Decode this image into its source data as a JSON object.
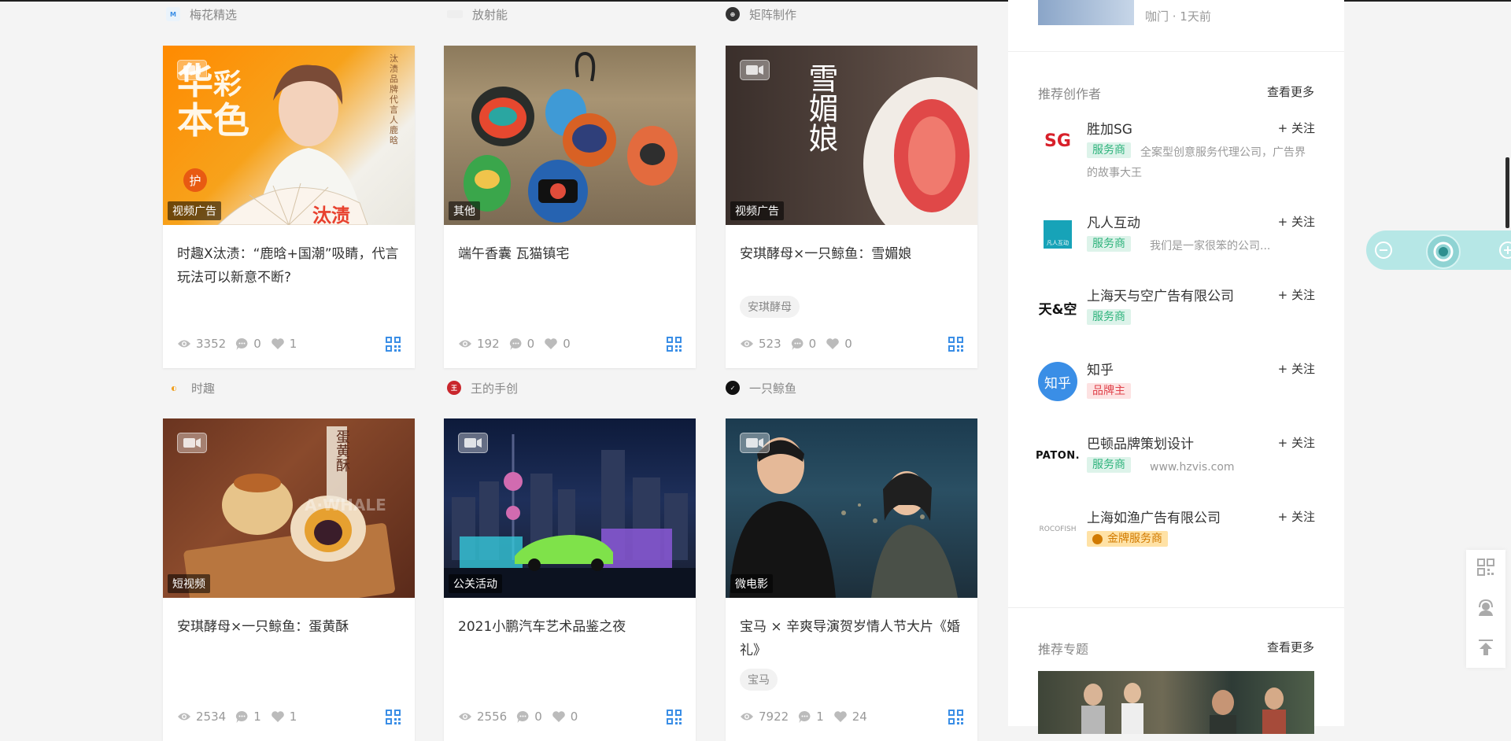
{
  "feed": {
    "authors": [
      {
        "name": "梅花精选"
      },
      {
        "name": "放射能"
      },
      {
        "name": "矩阵制作"
      },
      {
        "name": "时趣"
      },
      {
        "name": "王的手创"
      },
      {
        "name": "一只鲸鱼"
      }
    ],
    "cards": [
      {
        "category": "视频广告",
        "title": "时趣X汰渍：“鹿晗+国潮”吸睛，代言玩法可以新意不断?",
        "views": "3352",
        "comments": "0",
        "likes": "1",
        "has_video": true,
        "image_text": {
          "a": "华",
          "b": "彩",
          "c": "本",
          "d": "色",
          "e": "护",
          "f": "汰渍",
          "g": "汰渍品牌代言人 鹿晗"
        }
      },
      {
        "category": "其他",
        "title": "端午香囊 瓦猫镇宅",
        "views": "192",
        "comments": "0",
        "likes": "0",
        "has_video": false
      },
      {
        "category": "视频广告",
        "title": "安琪酵母×一只鲸鱼：雪媚娘",
        "tag": "安琪酵母",
        "views": "523",
        "comments": "0",
        "likes": "0",
        "has_video": true,
        "image_text": {
          "a": "雪",
          "b": "媚",
          "c": "娘"
        }
      },
      {
        "category": "短视频",
        "title": "安琪酵母×一只鲸鱼：蛋黄酥",
        "views": "2534",
        "comments": "1",
        "likes": "1",
        "has_video": true,
        "image_text": {
          "a": "蛋",
          "b": "黄",
          "c": "酥",
          "w": "A·WHALE"
        }
      },
      {
        "category": "公关活动",
        "title": "2021小鹏汽车艺术品鉴之夜",
        "views": "2556",
        "comments": "0",
        "likes": "0",
        "has_video": true
      },
      {
        "category": "微电影",
        "title": "宝马 × 辛爽导演贺岁情人节大片《婚礼》",
        "tag": "宝马",
        "views": "7922",
        "comments": "1",
        "likes": "24",
        "has_video": true
      }
    ]
  },
  "sidebar": {
    "top_item_meta": "咖门 · 1天前",
    "creators_title": "推荐创作者",
    "more_label": "查看更多",
    "creators": [
      {
        "name": "胜加SG",
        "badge": "服务商",
        "desc": "全案型创意服务代理公司，广告界的故事大王",
        "follow": "+ 关注",
        "logo_text": "SG"
      },
      {
        "name": "凡人互动",
        "badge": "服务商",
        "desc": "我们是一家很笨的公司...",
        "follow": "+ 关注",
        "logo_text": "凡人互动"
      },
      {
        "name": "上海天与空广告有限公司",
        "badge": "服务商",
        "desc": "",
        "follow": "+ 关注",
        "logo_text": "天&空"
      },
      {
        "name": "知乎",
        "badge": "品牌主",
        "desc": "",
        "follow": "+ 关注",
        "logo_text": "知乎"
      },
      {
        "name": "巴顿品牌策划设计",
        "badge": "服务商",
        "desc": "www.hzvis.com",
        "follow": "+ 关注",
        "logo_text": "PATON."
      },
      {
        "name": "上海如渔广告有限公司",
        "badge": "金牌服务商",
        "desc": "",
        "follow": "+ 关注",
        "logo_text": "ROCOFISH"
      }
    ],
    "topics_title": "推荐专题",
    "topics_more": "查看更多"
  },
  "colors": {
    "accent_blue": "#3a8ee6",
    "badge_green": "#2eb37c",
    "badge_red": "#e0424b",
    "badge_gold": "#d17a00",
    "zoom_widget": "#b6e7e6"
  },
  "icons": [
    "video-camera-icon",
    "eye-icon",
    "comment-icon",
    "heart-icon",
    "qr-code-icon",
    "zoom-out-icon",
    "zoom-in-icon",
    "headset-icon",
    "back-to-top-icon"
  ]
}
